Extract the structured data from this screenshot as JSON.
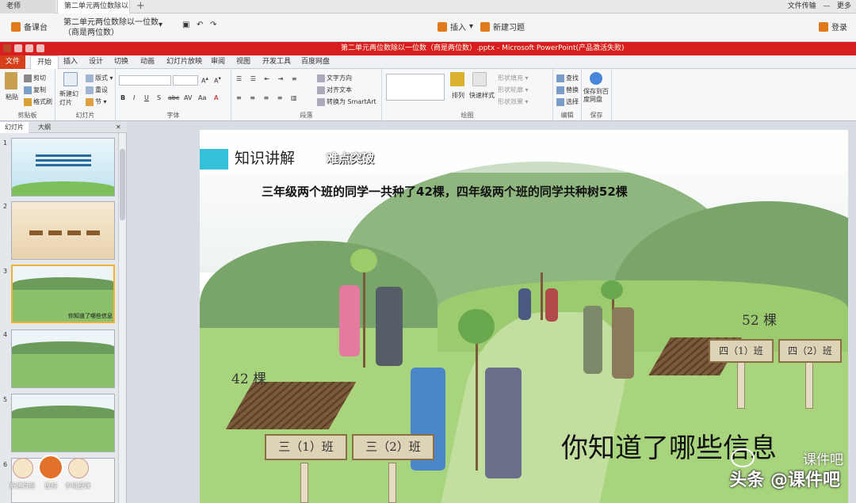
{
  "browser": {
    "tab1": "老师",
    "tab2": "第二单元两位数除以一...",
    "new_tab": "+",
    "top_right": [
      "文件传输",
      "更多"
    ]
  },
  "teacher_toolbar": {
    "prepare_label": "备课台",
    "doc_title": "第二单元两位数除以一位数（商是两位数）",
    "insert_label": "插入",
    "new_exercise_label": "新建习题",
    "login_label": "登录"
  },
  "ppt_title": "第二单元两位数除以一位数（商是两位数）.pptx - Microsoft PowerPoint(产品激活失败)",
  "ribbon_tabs": [
    "文件",
    "开始",
    "插入",
    "设计",
    "切换",
    "动画",
    "幻灯片放映",
    "审阅",
    "视图",
    "开发工具",
    "百度网盘"
  ],
  "ribbon": {
    "clipboard": {
      "paste": "粘贴",
      "cut": "剪切",
      "copy": "复制",
      "format_painter": "格式刷",
      "label": "剪贴板"
    },
    "slides": {
      "new_slide": "新建幻灯片",
      "layout": "版式",
      "reset": "重设",
      "section": "节",
      "label": "幻灯片"
    },
    "font": {
      "label": "字体"
    },
    "paragraph": {
      "text_direction": "文字方向",
      "align_text": "对齐文本",
      "smartart": "转换为 SmartArt",
      "label": "段落"
    },
    "drawing": {
      "arrange": "排列",
      "quick_styles": "快速样式",
      "shape_fill": "形状填充",
      "shape_outline": "形状轮廓",
      "shape_effects": "形状效果",
      "label": "绘图"
    },
    "editing": {
      "find": "查找",
      "replace": "替换",
      "select": "选择",
      "label": "编辑"
    },
    "save": {
      "save_to_baidu": "保存到百度网盘",
      "label": "保存"
    }
  },
  "pane": {
    "tab_slides": "幻灯片",
    "tab_outline": "大纲",
    "slide_numbers": [
      "1",
      "2",
      "3",
      "4",
      "5",
      "6"
    ],
    "thumb3_caption": "你知道了哪些信息",
    "bottom_labels": [
      "新建页面",
      "放映",
      "手机授课"
    ]
  },
  "slide": {
    "section_title": "知识讲解",
    "section_sub": "难点突破",
    "question": "三年级两个班的同学一共种了42棵，四年级两个班的同学共种树52棵",
    "count_left": "42 棵",
    "count_right": "52 棵",
    "signs": [
      "三（1）班",
      "三（2）班",
      "四（1）班",
      "四（2）班"
    ],
    "ask": "你知道了哪些信息"
  },
  "watermark": {
    "line1": "课件吧",
    "line2": "头条 @课件吧"
  },
  "colors": {
    "ppt_titlebar": "#d81e1e",
    "file_tab": "#d5401a",
    "accent_cyan": "#34c0d8",
    "grass": "#a8d47e"
  }
}
